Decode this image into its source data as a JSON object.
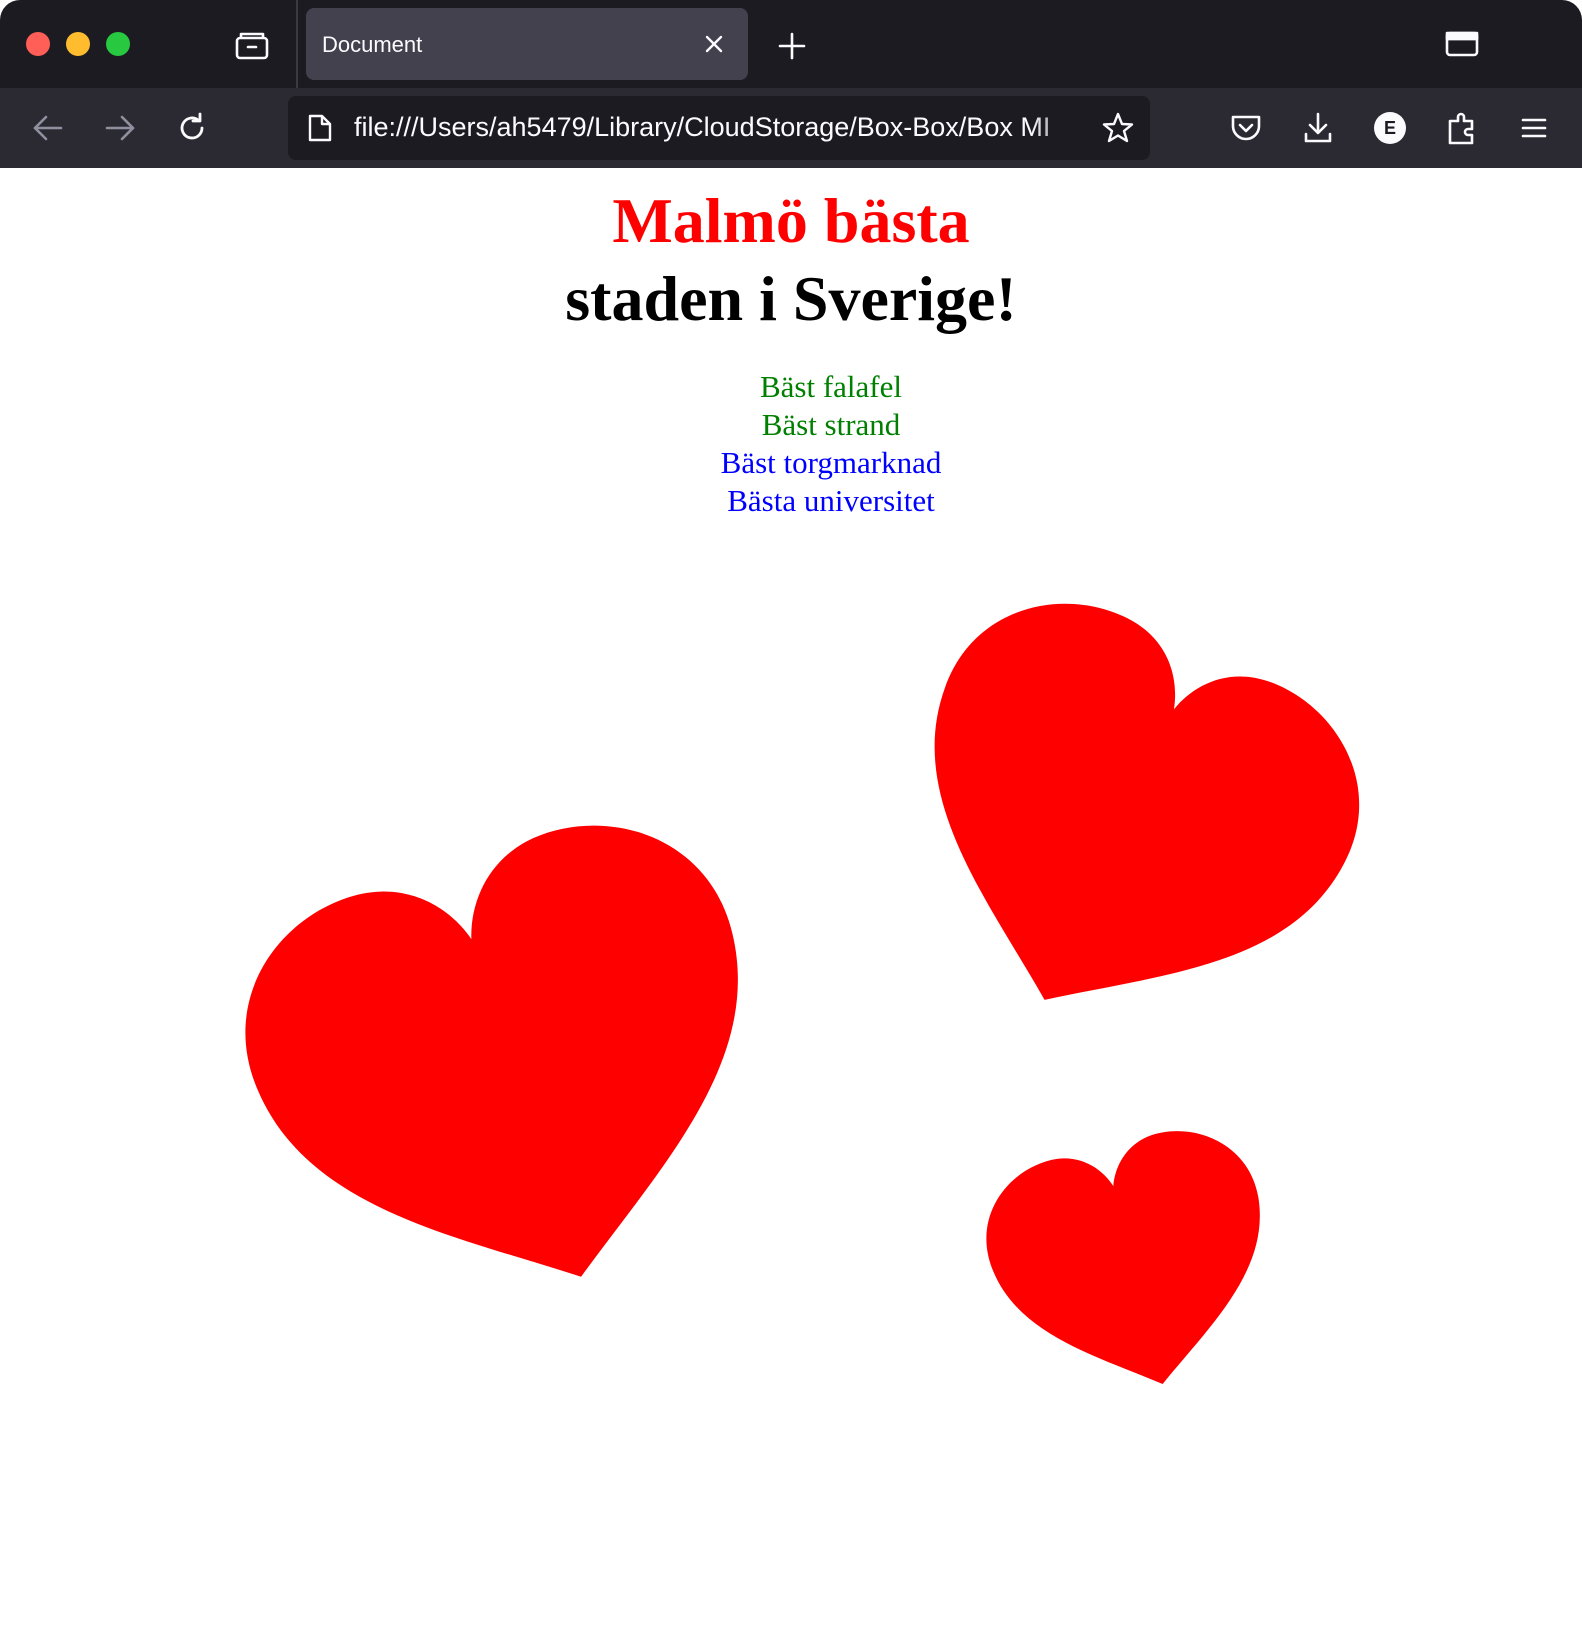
{
  "browser": {
    "tab": {
      "title": "Document"
    },
    "url": "file:///Users/ah5479/Library/CloudStorage/Box-Box/Box MI",
    "icons": {
      "tab_overview": "tab-overview-icon",
      "tab_close": "close-icon",
      "new_tab": "plus-icon",
      "tab_list": "tab-list-icon",
      "back": "arrow-left-icon",
      "forward": "arrow-right-icon",
      "reload": "reload-icon",
      "page": "page-icon",
      "bookmark": "star-icon",
      "pocket": "pocket-icon",
      "downloads": "download-icon",
      "extension_e": "extension-e-icon",
      "extensions": "puzzle-icon",
      "menu": "hamburger-icon"
    }
  },
  "page": {
    "heading_red": "Malmö bästa",
    "heading_black": "staden i Sverige!",
    "items": [
      {
        "text": "Bäst falafel",
        "color": "#008000"
      },
      {
        "text": "Bäst strand",
        "color": "#008000"
      },
      {
        "text": "Bäst torgmarknad",
        "color": "#0000ff"
      },
      {
        "text": "Bästa universitet",
        "color": "#0000ff"
      }
    ],
    "heart_color": "#ff0000"
  },
  "colors": {
    "tabstrip_bg": "#1c1b22",
    "toolbar_bg": "#2b2a33",
    "active_tab_bg": "#42414d",
    "close_dot": "#ff5f57",
    "minimize_dot": "#febc2e",
    "maximize_dot": "#28c840"
  }
}
